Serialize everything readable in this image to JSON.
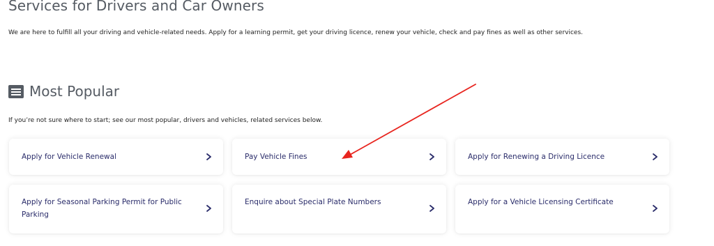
{
  "header": {
    "title": "Services for Drivers and Car Owners",
    "intro": "We are here to fulfill all your driving and vehicle-related needs. Apply for a learning permit, get your driving licence, renew your vehicle, check and pay fines as well as other services."
  },
  "popular": {
    "icon": "list-icon",
    "title": "Most Popular",
    "subtitle": "If you’re not sure where to start; see our most popular, drivers and vehicles, related services below.",
    "cards": [
      {
        "label": "Apply for Vehicle Renewal"
      },
      {
        "label": "Pay Vehicle Fines"
      },
      {
        "label": "Apply for Renewing a Driving Licence"
      },
      {
        "label": "Apply for Seasonal Parking Permit for Public Parking"
      },
      {
        "label": "Enquire about Special Plate Numbers"
      },
      {
        "label": "Apply for a Vehicle Licensing Certificate"
      }
    ]
  },
  "annotation": {
    "icon": "red-arrow",
    "color": "#e8251f"
  },
  "colors": {
    "heading": "#555b63",
    "card_text": "#2a2c6a",
    "chevron": "#2a2c6a"
  }
}
